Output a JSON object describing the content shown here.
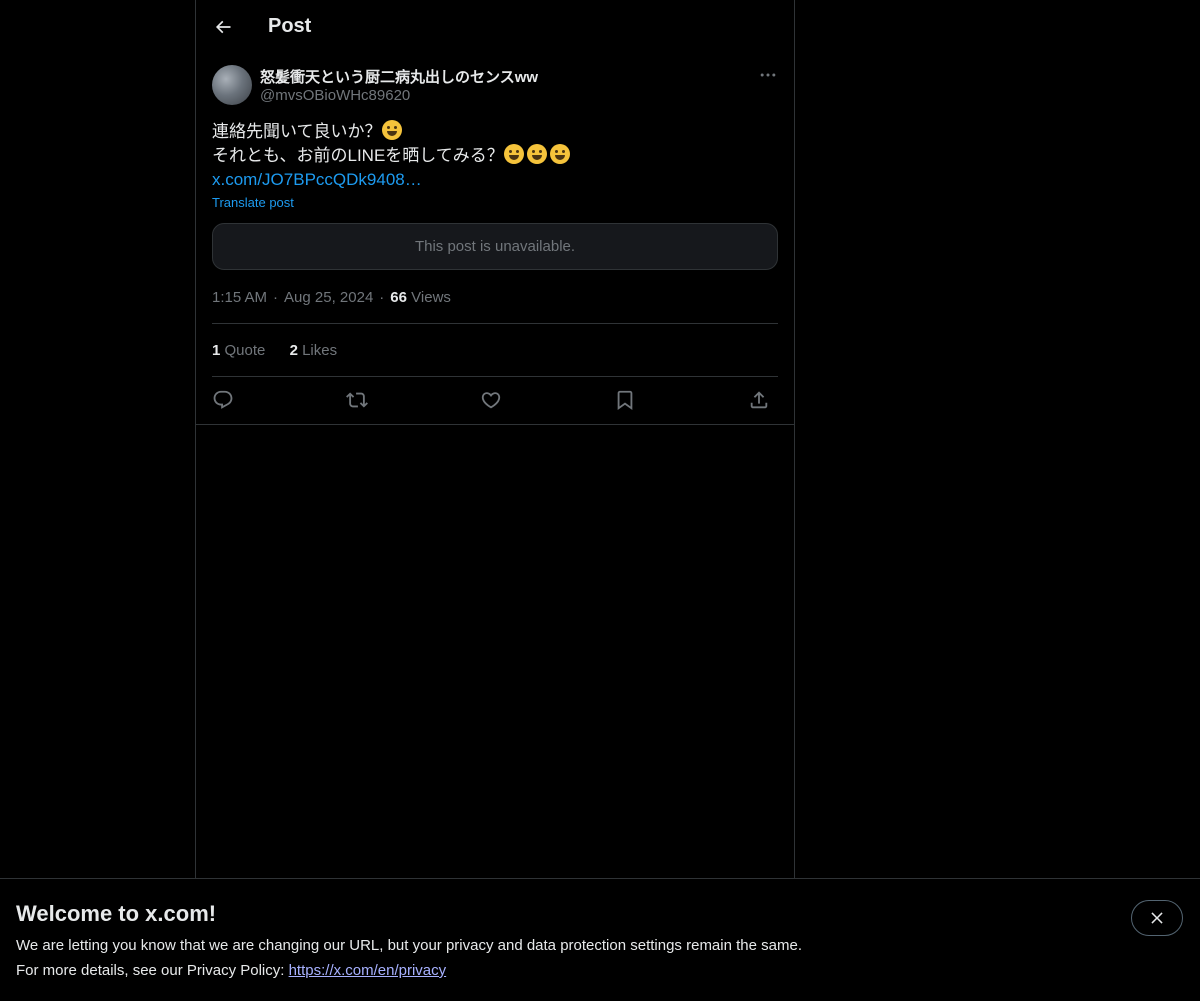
{
  "header": {
    "title": "Post"
  },
  "author": {
    "display_name": "怒髪衝天という厨二病丸出しのセンスww",
    "handle": "@mvsOBioWHc89620"
  },
  "tweet": {
    "line1": "連絡先聞いて良いか？",
    "line2": "それとも、お前のLINEを晒してみる？",
    "link": "x.com/JO7BPccQDk9408…",
    "translate": "Translate post",
    "unavailable": "This post is unavailable.",
    "time": "1:15 AM",
    "date": "Aug 25, 2024",
    "views_count": "66",
    "views_label": "Views"
  },
  "stats": {
    "quotes_count": "1",
    "quotes_label": "Quote",
    "likes_count": "2",
    "likes_label": "Likes"
  },
  "icons": [
    "arrow-left",
    "more-horizontal",
    "reply",
    "retweet",
    "like",
    "bookmark",
    "share",
    "close"
  ],
  "banner": {
    "title": "Welcome to x.com!",
    "line1": "We are letting you know that we are changing our URL, but your privacy and data protection settings remain the same.",
    "line2_prefix": "For more details, see our Privacy Policy: ",
    "link": "https://x.com/en/privacy"
  },
  "colors": {
    "background": "#000000",
    "accent": "#1d9bf0",
    "border": "#2f3336",
    "muted": "#71767b"
  }
}
